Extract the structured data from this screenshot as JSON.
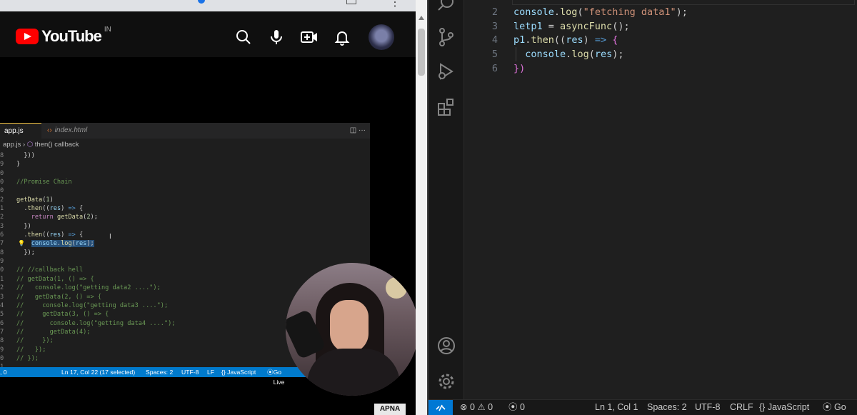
{
  "youtube": {
    "logo_text": "YouTube",
    "region": "IN",
    "icons": [
      "search-icon",
      "microphone-icon",
      "create-video-icon",
      "notifications-bell-icon",
      "avatar"
    ]
  },
  "video_editor": {
    "tabs": [
      {
        "label": "app.js",
        "active": true
      },
      {
        "label": "index.html",
        "active": false
      }
    ],
    "breadcrumb": {
      "file": "app.js",
      "symbol": "then() callback"
    },
    "lines": [
      {
        "n": "8",
        "code": "  }))"
      },
      {
        "n": "9",
        "code": "}"
      },
      {
        "n": "0",
        "code": ""
      },
      {
        "n": "0",
        "code": "//Promise Chain"
      },
      {
        "n": "0",
        "code": ""
      },
      {
        "n": "2",
        "code": "getData(1)"
      },
      {
        "n": "1",
        "code": "  .then((res) => {"
      },
      {
        "n": "2",
        "code": "    return getData(2);"
      },
      {
        "n": "3",
        "code": "  })"
      },
      {
        "n": "6",
        "code": "  .then((res) => {"
      },
      {
        "n": "7",
        "code": "    console.log(res);"
      },
      {
        "n": "8",
        "code": "  });"
      },
      {
        "n": "9",
        "code": ""
      },
      {
        "n": "0",
        "code": "// //callback hell"
      },
      {
        "n": "1",
        "code": "// getData(1, () => {"
      },
      {
        "n": "2",
        "code": "//   console.log(\"getting data2 ....\");"
      },
      {
        "n": "3",
        "code": "//   getData(2, () => {"
      },
      {
        "n": "4",
        "code": "//     console.log(\"getting data3 ....\");"
      },
      {
        "n": "5",
        "code": "//     getData(3, () => {"
      },
      {
        "n": "6",
        "code": "//       console.log(\"getting data4 ....\");"
      },
      {
        "n": "7",
        "code": "//       getData(4);"
      },
      {
        "n": "8",
        "code": "//     });"
      },
      {
        "n": "9",
        "code": "//   });"
      },
      {
        "n": "0",
        "code": "// });"
      },
      {
        "n": "1",
        "code": ""
      }
    ],
    "status": {
      "left": ", 0",
      "position": "Ln 17, Col 22 (17 selected)",
      "spaces": "Spaces: 2",
      "encoding": "UTF-8",
      "eol": "LF",
      "language": "{} JavaScript",
      "golive": "Go Live"
    }
  },
  "badge": "APNA",
  "vscode": {
    "lines": [
      {
        "n": "2",
        "code": "console.log(\"fetching data1\");"
      },
      {
        "n": "3",
        "code": "letp1 = asyncFunc();"
      },
      {
        "n": "4",
        "code": "p1.then((res) => {"
      },
      {
        "n": "5",
        "code": "  console.log(res);"
      },
      {
        "n": "6",
        "code": "})"
      }
    ],
    "status": {
      "errors": "0",
      "warnings": "0",
      "ports": "0",
      "position": "Ln 1, Col 1",
      "spaces": "Spaces: 2",
      "encoding": "UTF-8",
      "eol": "CRLF",
      "language": "{} JavaScript",
      "golive": "Go Liv"
    }
  },
  "colors": {
    "accent": "#0078d4",
    "inner_status": "#007acc",
    "yt_red": "#ff0000"
  }
}
